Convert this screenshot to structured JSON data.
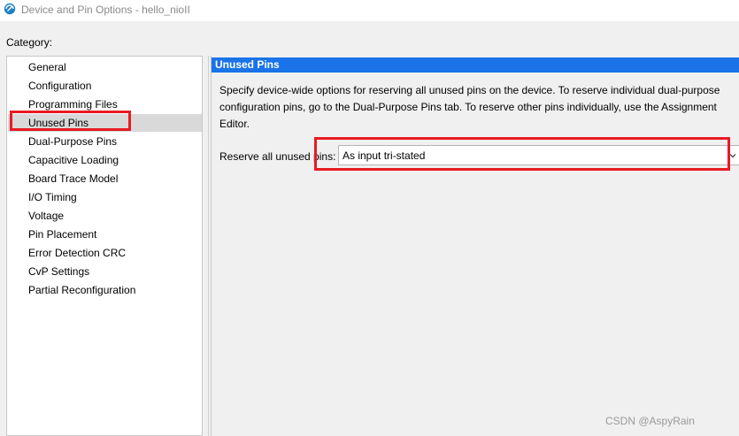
{
  "window": {
    "title": "Device and Pin Options - hello_nioII",
    "icon": "quartus-app-icon"
  },
  "category": {
    "label": "Category:",
    "items": [
      {
        "label": "General"
      },
      {
        "label": "Configuration"
      },
      {
        "label": "Programming Files"
      },
      {
        "label": "Unused Pins",
        "selected": true
      },
      {
        "label": "Dual-Purpose Pins"
      },
      {
        "label": "Capacitive Loading"
      },
      {
        "label": "Board Trace Model"
      },
      {
        "label": "I/O Timing"
      },
      {
        "label": "Voltage"
      },
      {
        "label": "Pin Placement"
      },
      {
        "label": "Error Detection CRC"
      },
      {
        "label": "CvP Settings"
      },
      {
        "label": "Partial Reconfiguration"
      }
    ]
  },
  "panel": {
    "header": "Unused Pins",
    "description": "Specify device-wide options for reserving all unused pins on the device. To reserve individual dual-purpose configuration pins, go to the Dual-Purpose Pins tab. To reserve other pins individually, use the Assignment Editor.",
    "reserve_label": "Reserve all unused pins:",
    "reserve_value": "As input tri-stated"
  },
  "watermark": "CSDN @AspyRain",
  "colors": {
    "header_bg": "#1a73e8",
    "highlight_box": "#e81b23",
    "selected_item_bg": "#d9d9d9"
  }
}
